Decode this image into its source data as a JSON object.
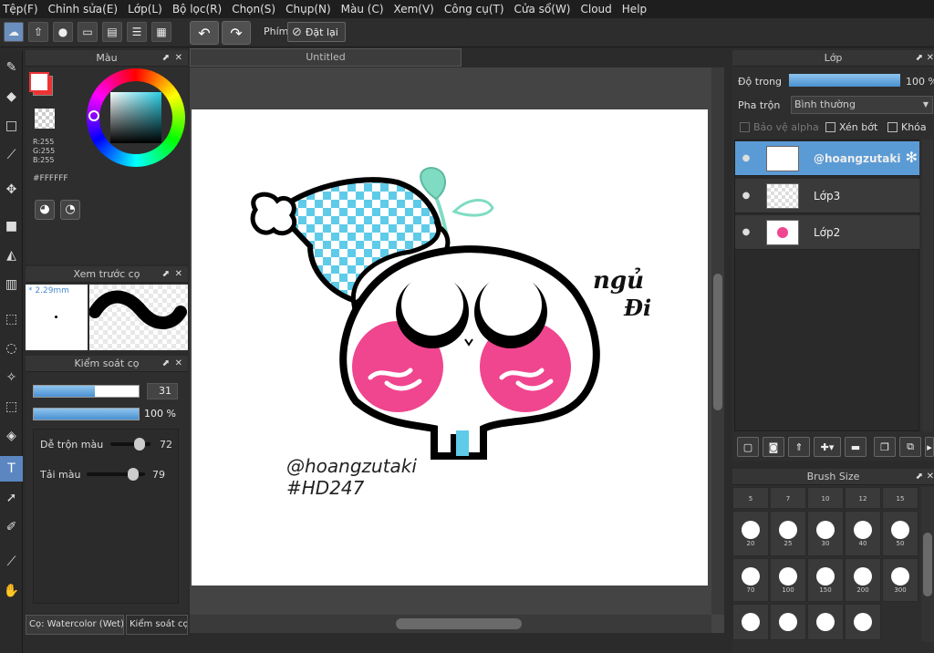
{
  "menu": [
    "Tệp(F)",
    "Chỉnh sửa(E)",
    "Lớp(L)",
    "Bộ lọc(R)",
    "Chọn(S)",
    "Chụp(N)",
    "Màu (C)",
    "Xem(V)",
    "Công cụ(T)",
    "Cửa sổ(W)",
    "Cloud",
    "Help"
  ],
  "toolbar": {
    "shortcut_label": "Phím",
    "reset_label": "Đặt lại"
  },
  "canvas": {
    "tab_title": "Untitled"
  },
  "color_panel": {
    "title": "Màu",
    "r": "R:255",
    "g": "G:255",
    "b": "B:255",
    "hex": "#FFFFFF"
  },
  "brush_preview": {
    "title": "Xem trước cọ",
    "size": "2.29mm"
  },
  "brush_control": {
    "title": "Kiểm soát cọ",
    "size_value": "31",
    "size_fraction": 0.58,
    "opacity_value": "100 %",
    "opacity_fraction": 1.0,
    "mix_label": "Dễ trộn màu",
    "mix_value": "72",
    "mix_fraction": 0.72,
    "load_label": "Tải màu",
    "load_value": "79",
    "load_fraction": 0.79
  },
  "bottom_tabs": {
    "tab1": "Cọ: Watercolor (Wet)",
    "tab2": "Kiểm soát cọ"
  },
  "layers_panel": {
    "title": "Lớp",
    "opacity_label": "Độ trong",
    "opacity_value": "100 %",
    "opacity_fraction": 1.0,
    "blend_label": "Pha trộn",
    "blend_value": "Bình thường",
    "protect_alpha": "Bảo vệ alpha",
    "clipping": "Xén bớt",
    "lock": "Khóa",
    "layers": [
      {
        "name": "@hoangzutaki",
        "selected": true
      },
      {
        "name": "Lớp3",
        "selected": false
      },
      {
        "name": "Lớp2",
        "selected": false
      }
    ]
  },
  "brush_size": {
    "title": "Brush Size",
    "row0": [
      "5",
      "7",
      "10",
      "12",
      "15"
    ],
    "row1": [
      "20",
      "25",
      "30",
      "40",
      "50"
    ],
    "row2": [
      "70",
      "100",
      "150",
      "200",
      "300"
    ]
  },
  "artwork": {
    "caption1": "@hoangzutaki",
    "caption2": "#HD247",
    "title1": "ngủ",
    "title2": "Đi"
  },
  "colors": {
    "accent": "#5b9bd5",
    "pink": "#f0458f",
    "cyan": "#5ecbe8",
    "mint": "#7fdcc3"
  }
}
